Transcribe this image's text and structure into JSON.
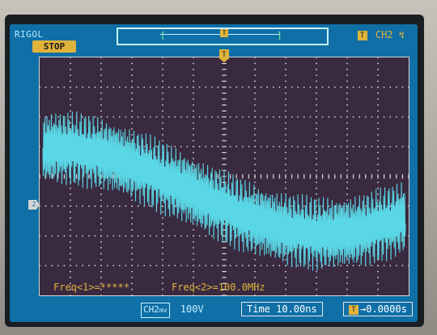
{
  "header": {
    "brand": "RIGOL",
    "run_status": "STOP",
    "trigger_source": "CH2",
    "trigger_slope_symbol": "↯",
    "trigger_badge": "T"
  },
  "measurements": {
    "freq1": "Freq<1>=*****",
    "freq2": "Freq<2>=100.0MHz"
  },
  "status": {
    "channel": "CH2",
    "channel_suffix": "mv",
    "volts_per_div": "100V",
    "timebase": "Time 10.00ns",
    "trigger_offset": "0.0000s",
    "trigger_badge": "T"
  },
  "markers": {
    "trigger_t": "T",
    "channel_level": "2"
  },
  "colors": {
    "trace": "#5ad7e6",
    "grid": "#d8d8d8",
    "screen_bg": "#3a2a40",
    "accent": "#e0b33a"
  }
}
